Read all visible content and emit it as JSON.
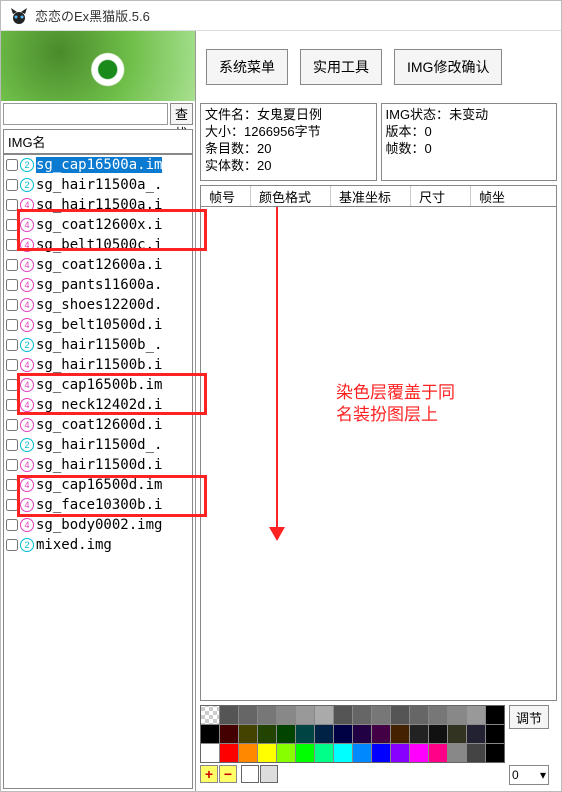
{
  "window": {
    "title": "恋恋のEx黑猫版.5.6"
  },
  "toolbar": {
    "menu_label": "系统菜单",
    "tools_label": "实用工具",
    "confirm_label": "IMG修改确认"
  },
  "search": {
    "placeholder": "",
    "button": "查找"
  },
  "left_header": "IMG名",
  "file_info": {
    "filename_label": "文件名：",
    "filename": "女鬼夏日例",
    "size_label": "大小：",
    "size": "1266956字节",
    "entries_label": "条目数：",
    "entries": "20",
    "entities_label": "实体数：",
    "entities": "20"
  },
  "img_status": {
    "status_label": "IMG状态：",
    "status": "未变动",
    "version_label": "版本：",
    "version": "0",
    "frames_label": "帧数：",
    "frames": "0"
  },
  "frame_cols": {
    "c1": "帧号",
    "c2": "颜色格式",
    "c3": "基准坐标",
    "c4": "尺寸",
    "c5": "帧坐"
  },
  "files": [
    {
      "badge": "2",
      "name": "sg_cap16500a.im",
      "selected": true
    },
    {
      "badge": "2",
      "name": "sg_hair11500a_."
    },
    {
      "badge": "4",
      "name": "sg_hair11500a.i"
    },
    {
      "badge": "4",
      "name": "sg_coat12600x.i"
    },
    {
      "badge": "4",
      "name": "sg_belt10500c.i"
    },
    {
      "badge": "4",
      "name": "sg_coat12600a.i"
    },
    {
      "badge": "4",
      "name": "sg_pants11600a."
    },
    {
      "badge": "4",
      "name": "sg_shoes12200d."
    },
    {
      "badge": "4",
      "name": "sg_belt10500d.i"
    },
    {
      "badge": "2",
      "name": "sg_hair11500b_."
    },
    {
      "badge": "4",
      "name": "sg_hair11500b.i"
    },
    {
      "badge": "4",
      "name": "sg_cap16500b.im"
    },
    {
      "badge": "4",
      "name": "sg_neck12402d.i"
    },
    {
      "badge": "4",
      "name": "sg_coat12600d.i"
    },
    {
      "badge": "2",
      "name": "sg_hair11500d_."
    },
    {
      "badge": "4",
      "name": "sg_hair11500d.i"
    },
    {
      "badge": "4",
      "name": "sg_cap16500d.im"
    },
    {
      "badge": "4",
      "name": "sg_face10300b.i"
    },
    {
      "badge": "4",
      "name": "sg_body0002.img"
    },
    {
      "badge": "2",
      "name": "mixed.img"
    }
  ],
  "annotation": {
    "line1": "染色层覆盖于同",
    "line2": "名装扮图层上"
  },
  "palette_side": {
    "adjust": "调节",
    "spin": "0"
  },
  "palette_row1": [
    "#fff",
    "#555",
    "#666",
    "#777",
    "#888",
    "#999",
    "#aaa",
    "#555",
    "#666",
    "#777",
    "#555",
    "#666",
    "#777",
    "#888",
    "#999",
    "#000"
  ],
  "palette_row2": [
    "#000",
    "#400",
    "#440",
    "#240",
    "#040",
    "#044",
    "#024",
    "#004",
    "#204",
    "#404",
    "#420",
    "#222",
    "#111",
    "#332",
    "#223",
    "#000"
  ],
  "palette_row3": [
    "#fff",
    "#f00",
    "#f80",
    "#ff0",
    "#8f0",
    "#0f0",
    "#0f8",
    "#0ff",
    "#08f",
    "#00f",
    "#80f",
    "#f0f",
    "#f08",
    "#888",
    "#444",
    "#000"
  ],
  "src_swatches": [
    "#fff",
    "#ddd"
  ]
}
